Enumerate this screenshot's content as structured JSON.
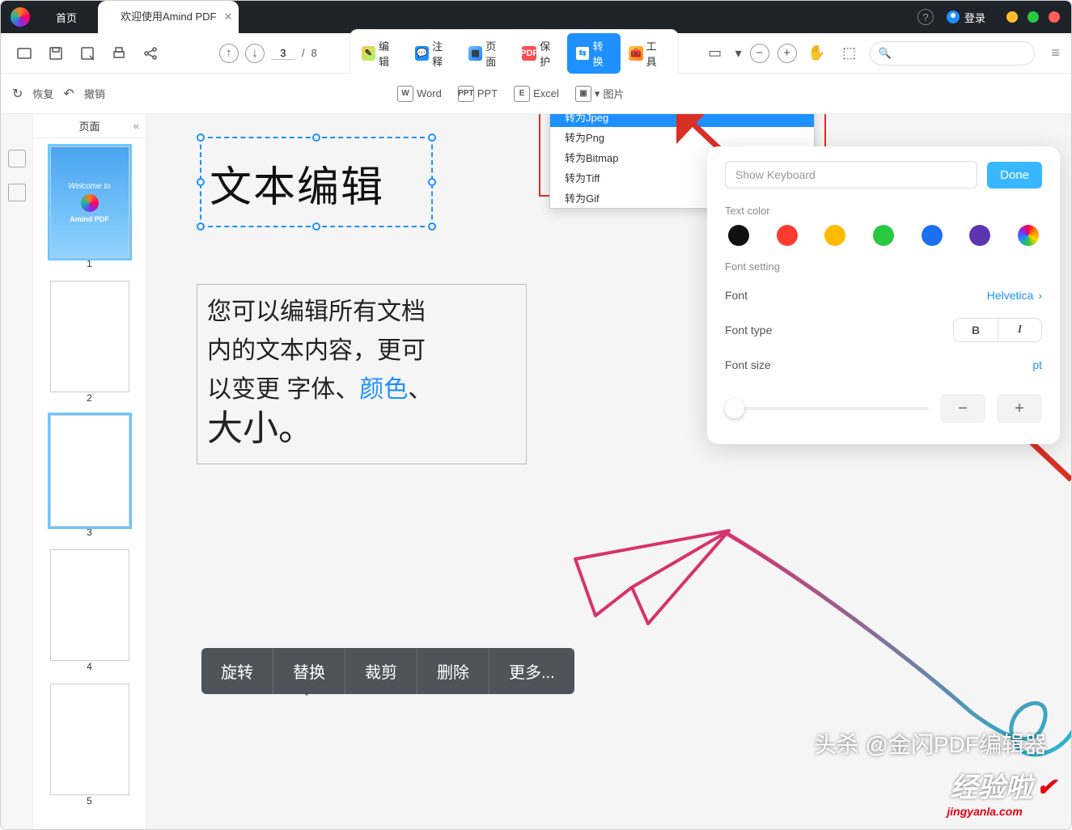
{
  "titlebar": {
    "home": "首页",
    "doc_name": "欢迎使用Amind PDF",
    "login": "登录"
  },
  "toolbar": {
    "page_current": "3",
    "page_sep": "/",
    "page_total": "8",
    "modes": {
      "edit": "编辑",
      "annotate": "注释",
      "page": "页面",
      "protect": "保护",
      "convert": "转换",
      "tools": "工具"
    }
  },
  "undo_redo": {
    "redo": "恢复",
    "undo": "撤销"
  },
  "convert_targets": {
    "word": "Word",
    "ppt": "PPT",
    "excel": "Excel",
    "image": "图片"
  },
  "image_menu": {
    "jpeg": "转为Jpeg",
    "png": "转为Png",
    "bitmap": "转为Bitmap",
    "tiff": "转为Tiff",
    "gif": "转为Gif"
  },
  "thumbs": {
    "header": "页面",
    "p1": "1",
    "p2": "2",
    "p3": "3",
    "p4": "4",
    "p5": "5",
    "cover_title": "Welcome to",
    "cover_name": "Amind PDF"
  },
  "sel_text": "文本编辑",
  "para": {
    "l1a": "您可以编辑所有文档",
    "l2a": "内的文本内容，更可",
    "l3a": "以变更 字体、",
    "l3b": "颜色",
    "l3c": "、",
    "l4a": "大小。"
  },
  "ctx": {
    "rotate": "旋转",
    "replace": "替换",
    "crop": "裁剪",
    "delete": "删除",
    "more": "更多..."
  },
  "props": {
    "show_keyboard": "Show Keyboard",
    "done": "Done",
    "text_color": "Text color",
    "font_setting": "Font setting",
    "font_label": "Font",
    "font_value": "Helvetica",
    "font_type_label": "Font type",
    "bold": "B",
    "italic": "I",
    "font_size_label": "Font size",
    "size_unit": "pt",
    "minus": "−",
    "plus": "+",
    "colors": [
      "#111111",
      "#ff3b30",
      "#ffbb00",
      "#28c840",
      "#1d6ff2",
      "#5e35b1"
    ]
  },
  "watermark": {
    "line1": "头杀 @金闪PDF编辑器",
    "brand": "经验啦",
    "domain": "jingyanla.com"
  }
}
